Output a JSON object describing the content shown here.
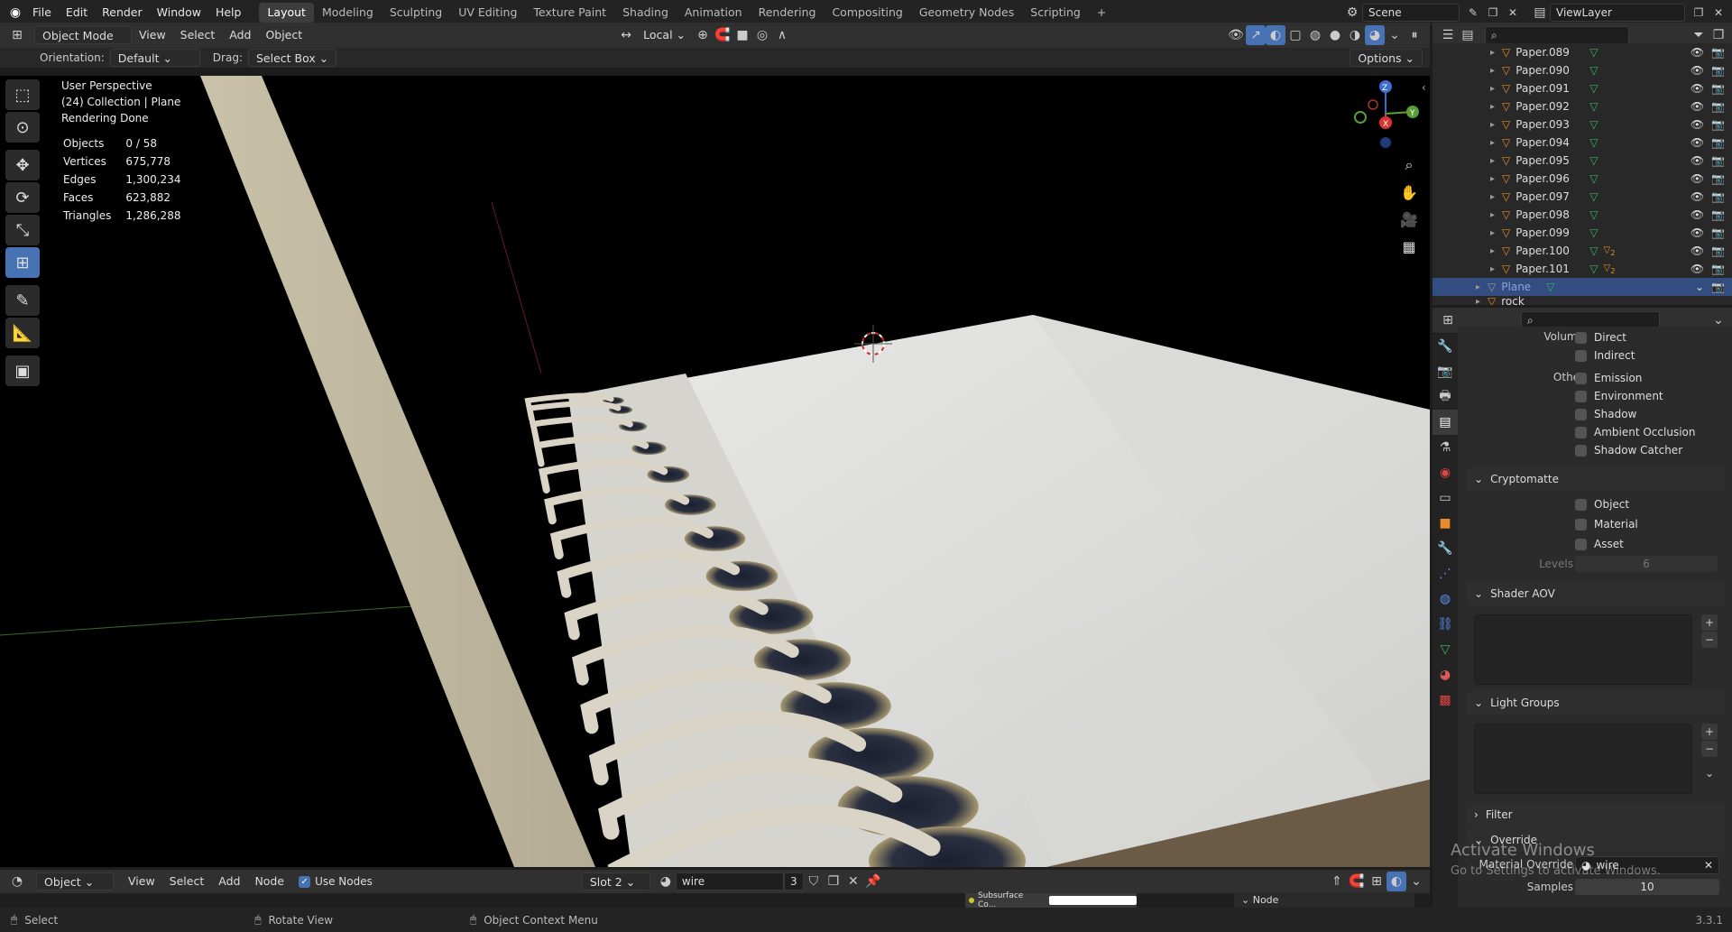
{
  "topbar": {
    "menus": [
      "File",
      "Edit",
      "Render",
      "Window",
      "Help"
    ],
    "workspaces": [
      "Layout",
      "Modeling",
      "Sculpting",
      "UV Editing",
      "Texture Paint",
      "Shading",
      "Animation",
      "Rendering",
      "Compositing",
      "Geometry Nodes",
      "Scripting"
    ],
    "active_workspace": "Layout",
    "add_tab": "+",
    "scene": "Scene",
    "view_layer": "ViewLayer"
  },
  "viewport_header": {
    "mode": "Object Mode",
    "menus": [
      "View",
      "Select",
      "Add",
      "Object"
    ],
    "transform_orientation": "Local",
    "options_label": "Options"
  },
  "tool_settings": {
    "orientation_label": "Orientation:",
    "orientation_value": "Default",
    "drag_label": "Drag:",
    "drag_value": "Select Box"
  },
  "viewport_info": {
    "line1": "User Perspective",
    "line2": "(24) Collection | Plane",
    "line3": "Rendering Done",
    "stats": [
      {
        "label": "Objects",
        "value": "0 / 58"
      },
      {
        "label": "Vertices",
        "value": "675,778"
      },
      {
        "label": "Edges",
        "value": "1,300,234"
      },
      {
        "label": "Faces",
        "value": "623,882"
      },
      {
        "label": "Triangles",
        "value": "1,286,288"
      }
    ]
  },
  "gizmo": {
    "x": "X",
    "y": "Y",
    "z": "Z"
  },
  "outliner": {
    "rows": [
      {
        "name": "Paper.089",
        "badge": ""
      },
      {
        "name": "Paper.090",
        "badge": ""
      },
      {
        "name": "Paper.091",
        "badge": ""
      },
      {
        "name": "Paper.092",
        "badge": ""
      },
      {
        "name": "Paper.093",
        "badge": ""
      },
      {
        "name": "Paper.094",
        "badge": ""
      },
      {
        "name": "Paper.095",
        "badge": ""
      },
      {
        "name": "Paper.096",
        "badge": ""
      },
      {
        "name": "Paper.097",
        "badge": ""
      },
      {
        "name": "Paper.098",
        "badge": ""
      },
      {
        "name": "Paper.099",
        "badge": ""
      },
      {
        "name": "Paper.100",
        "badge": "2"
      },
      {
        "name": "Paper.101",
        "badge": "2"
      }
    ],
    "selected": "Plane",
    "partial": "rock"
  },
  "properties": {
    "volume_label": "Volume",
    "volume_items": [
      "Direct",
      "Indirect"
    ],
    "other_label": "Other",
    "other_items": [
      "Emission",
      "Environment",
      "Shadow",
      "Ambient Occlusion",
      "Shadow Catcher"
    ],
    "cryptomatte": {
      "title": "Cryptomatte",
      "items": [
        "Object",
        "Material",
        "Asset"
      ],
      "levels_label": "Levels",
      "levels_value": "6"
    },
    "shader_aov": {
      "title": "Shader AOV"
    },
    "light_groups": {
      "title": "Light Groups"
    },
    "filter": {
      "title": "Filter"
    },
    "override": {
      "title": "Override",
      "material_label": "Material Override",
      "material_value": "wire",
      "samples_label": "Samples",
      "samples_value": "10"
    }
  },
  "node_header": {
    "editor_type": "Object",
    "menus": [
      "View",
      "Select",
      "Add",
      "Node"
    ],
    "use_nodes": "Use Nodes",
    "slot": "Slot 2",
    "material": "wire",
    "users": "3",
    "node_preview": "Subsurface Co...",
    "side_tab": "Node"
  },
  "statusbar": {
    "select": "Select",
    "rotate": "Rotate View",
    "context": "Object Context Menu",
    "version": "3.3.1"
  },
  "watermark": {
    "line1": "Activate Windows",
    "line2": "Go to Settings to activate Windows."
  }
}
